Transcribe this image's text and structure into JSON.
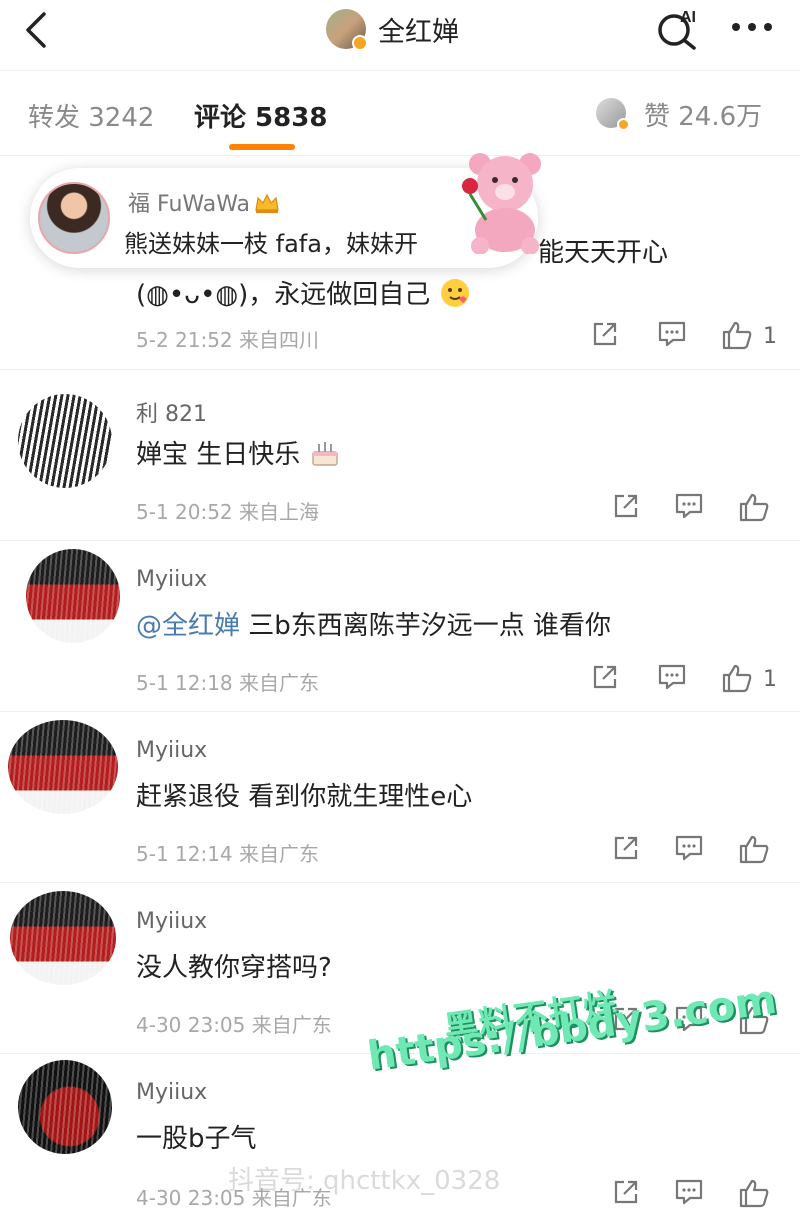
{
  "header": {
    "title": "全红婵",
    "ai_label": "AI"
  },
  "tabs": {
    "repost": "转发 3242",
    "comments": "评论 5838",
    "likes": "赞 24.6万"
  },
  "gift_banner": {
    "user": "福 FuWaWa",
    "message": "熊送妹妹一枝 fafa，妹妹开"
  },
  "comments": [
    {
      "name": "",
      "line1": "能天天开心",
      "line2": "(◍•ᴗ•◍)，永远做回自己",
      "time": "5-2 21:52",
      "location": "来自四川",
      "likes": "1"
    },
    {
      "name": "利 821",
      "line1": "婵宝 生日快乐",
      "time": "5-1 20:52",
      "location": "来自上海",
      "likes": ""
    },
    {
      "name": "Myiiux",
      "mention": "@全红婵",
      "line1": " 三b东西离陈芋汐远一点  谁看你",
      "time": "5-1 12:18",
      "location": "来自广东",
      "likes": "1"
    },
    {
      "name": "Myiiux",
      "line1": "赶紧退役  看到你就生理性e心",
      "time": "5-1 12:14",
      "location": "来自广东",
      "likes": ""
    },
    {
      "name": "Myiiux",
      "line1": "没人教你穿搭吗?",
      "time": "4-30 23:05",
      "location": "来自广东",
      "likes": ""
    },
    {
      "name": "Myiiux",
      "line1": "一股b子气",
      "time": "4-30 23:05",
      "location": "来自广东",
      "likes": ""
    }
  ],
  "watermark": {
    "line1": "黑料不打烊",
    "line2": "https://bbdy3.com",
    "faint": "抖音号: qhcttkx_0328"
  },
  "icons": {
    "back": "chevron-left-icon",
    "search_ai": "ai-search-icon",
    "more": "more-dots-icon",
    "repost": "share-icon",
    "comment": "comment-icon",
    "like": "thumbs-up-icon"
  },
  "colors": {
    "accent": "#ff8200",
    "mention": "#4a7bb0",
    "watermark": "#6fe8b3"
  }
}
